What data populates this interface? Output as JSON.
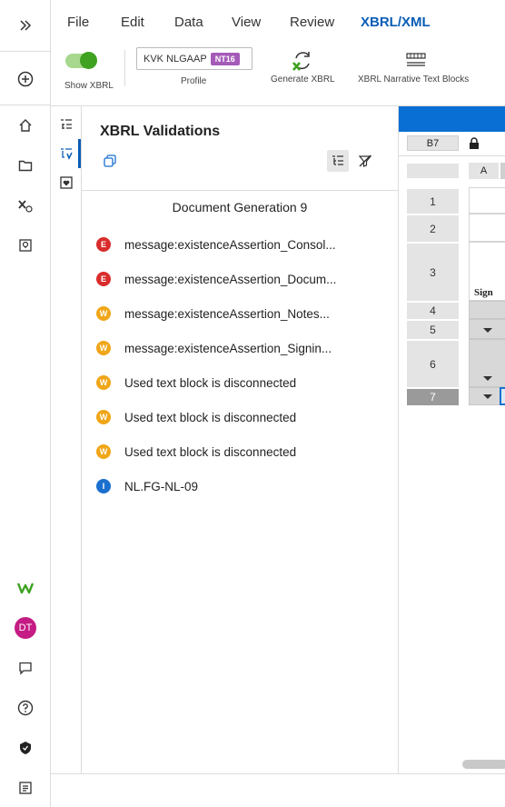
{
  "menu": {
    "items": [
      {
        "label": "File"
      },
      {
        "label": "Edit"
      },
      {
        "label": "Data"
      },
      {
        "label": "View"
      },
      {
        "label": "Review"
      },
      {
        "label": "XBRL/XML"
      }
    ],
    "active": "XBRL/XML"
  },
  "toolbar": {
    "show_xbrl_label": "Show XBRL",
    "show_xbrl_on": true,
    "profile_value": "KVK NLGAAP",
    "profile_badge": "NT16",
    "profile_label": "Profile",
    "generate_label": "Generate XBRL",
    "narrative_label": "XBRL Narrative Text Blocks"
  },
  "sidebar": {
    "avatar_initials": "DT",
    "brand_color": "#3fa220",
    "avatar_color": "#c41c84"
  },
  "panel": {
    "title": "XBRL Validations",
    "document_generation": "Document Generation 9",
    "items": [
      {
        "severity": "E",
        "text": "message:existenceAssertion_Consol..."
      },
      {
        "severity": "E",
        "text": "message:existenceAssertion_Docum..."
      },
      {
        "severity": "W",
        "text": "message:existenceAssertion_Notes..."
      },
      {
        "severity": "W",
        "text": "message:existenceAssertion_Signin..."
      },
      {
        "severity": "W",
        "text": "Used text block is disconnected"
      },
      {
        "severity": "W",
        "text": "Used text block is disconnected"
      },
      {
        "severity": "W",
        "text": "Used text block is disconnected"
      },
      {
        "severity": "I",
        "text": "NL.FG-NL-09"
      }
    ],
    "severity_colors": {
      "E": "#d92c2c",
      "W": "#f0a618",
      "I": "#1a6fcf"
    }
  },
  "sheet": {
    "cell_ref": "B7",
    "column_a": "A",
    "rows": [
      "1",
      "2",
      "3",
      "4",
      "5",
      "6",
      "7"
    ],
    "selected_row": "7",
    "cell_text_row3": "Sign"
  }
}
